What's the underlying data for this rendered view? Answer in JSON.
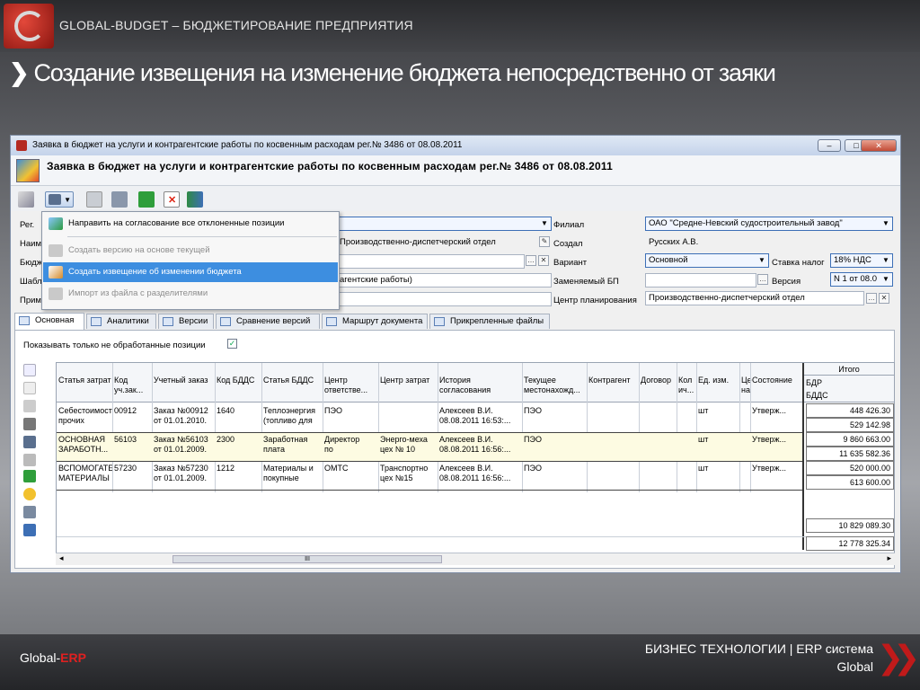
{
  "slide": {
    "brand_title": "GLOBAL-BUDGET – БЮДЖЕТИРОВАНИЕ ПРЕДПРИЯТИЯ",
    "headline_chevron": "❯",
    "headline": "Создание извещения на изменение бюджета непосредственно от заяки",
    "footer_left_prefix": "Global-",
    "footer_left_accent": "ERP",
    "footer_right_line1": "БИЗНЕС ТЕХНОЛОГИИ | ERP система",
    "footer_right_line2": "Global",
    "footer_chevrons": "❯❯",
    "colors": {
      "accent_red": "#c01a1a",
      "selection_blue": "#3d8ee0"
    }
  },
  "window": {
    "title": "Заявка в бюджет на услуги и контрагентские работы по косвенным расходам рег.№ 3486 от 08.08.2011",
    "header_title": "Заявка в бюджет на услуги и контрагентские работы по косвенным расходам рег.№ 3486 от 08.08.2011",
    "minimize": "–",
    "maximize": "□",
    "close": "✕"
  },
  "toolbar": {
    "icons": [
      "edit-icon",
      "split-icon",
      "dropdown-arrow-icon",
      "delete-icon",
      "save-icon",
      "refresh-icon",
      "close-doc-icon",
      "exit-icon"
    ]
  },
  "form": {
    "left_labels": [
      "Рег.",
      "Наим",
      "Бюдж",
      "Шабл",
      "Прим"
    ],
    "division_value": "Производственно-диспетчерский отдел",
    "template_value": "агентские работы)",
    "right": {
      "filial_label": "Филиал",
      "filial_value": "ОАО \"Средне-Невский судостроительный завод\"",
      "created_label": "Создал",
      "created_value": "Русских А.В.",
      "variant_label": "Вариант",
      "variant_value": "Основной",
      "vat_label": "Ставка налог",
      "vat_value": "18% НДС",
      "replaced_label": "Заменяемый БП",
      "version_label": "Версия",
      "version_value": "N 1 от 08.0",
      "center_label": "Центр планирования",
      "center_value": "Производственно-диспетчерский отдел"
    }
  },
  "menu": {
    "items": [
      {
        "label": "Направить на согласование все отклоненные позиции",
        "state": "normal"
      },
      {
        "label": "Создать версию на основе текущей",
        "state": "disabled"
      },
      {
        "label": "Создать извещение об изменении бюджета",
        "state": "selected"
      },
      {
        "label": "Импорт из файла с разделителями",
        "state": "disabled"
      }
    ]
  },
  "tabs": [
    "Основная",
    "Аналитики",
    "Версии",
    "Сравнение версий",
    "Маршрут документа",
    "Прикрепленные файлы"
  ],
  "filter": {
    "label": "Показывать только не обработанные позиции",
    "checked": "✓"
  },
  "grid": {
    "headers": [
      "Статья затрат",
      "Код\nуч.зак...",
      "Учетный заказ",
      "Код БДДС",
      "Статья БДДС",
      "Центр\nответстве...",
      "Центр затрат",
      "История\nсогласования",
      "Текущее\nместонахожд...",
      "Контрагент",
      "Договор",
      "Кол\nич...",
      "Ед. изм.",
      "Це\nна",
      "Состояние"
    ],
    "total_header": "Итого",
    "total_sub1": "БДР",
    "total_sub2": "БДДС",
    "rows": [
      {
        "cells": [
          "Себестоимост\nпрочих",
          "00912",
          "Заказ №00912\nот 01.01.2010.",
          "1640",
          "Теплоэнергия\n(топливо для",
          "ПЭО",
          "",
          "Алексеев В.И.\n08.08.2011 16:53:...",
          "ПЭО",
          "",
          "",
          "",
          "шт",
          "",
          "Утверж..."
        ],
        "bdr": "448 426.30",
        "bdds": "529 142.98"
      },
      {
        "cells": [
          "ОСНОВНАЯ\nЗАРАБОТН...",
          "56103",
          "Заказ №56103\nот 01.01.2009.",
          "2300",
          "Заработная\nплата",
          "Директор\nпо",
          "Энерго-меха\nцех № 10",
          "Алексеев В.И.\n08.08.2011 16:56:...",
          "ПЭО",
          "",
          "",
          "",
          "шт",
          "",
          "Утверж..."
        ],
        "bdr": "9 860 663.00",
        "bdds": "11 635 582.36"
      },
      {
        "cells": [
          "ВСПОМОГАТЕ\nМАТЕРИАЛЫ",
          "57230",
          "Заказ №57230\nот 01.01.2009.",
          "1212",
          "Материалы и\nпокупные",
          "ОМТС",
          "Транспортно\nцех №15",
          "Алексеев В.И.\n08.08.2011 16:56:...",
          "ПЭО",
          "",
          "",
          "",
          "шт",
          "",
          "Утверж..."
        ],
        "bdr": "520 000.00",
        "bdds": "613 600.00"
      }
    ],
    "grand_bdr": "10 829 089.30",
    "grand_bdds": "12 778 325.34",
    "scroll_left": "◂",
    "scroll_right": "▸",
    "scroll_grip": "III"
  }
}
